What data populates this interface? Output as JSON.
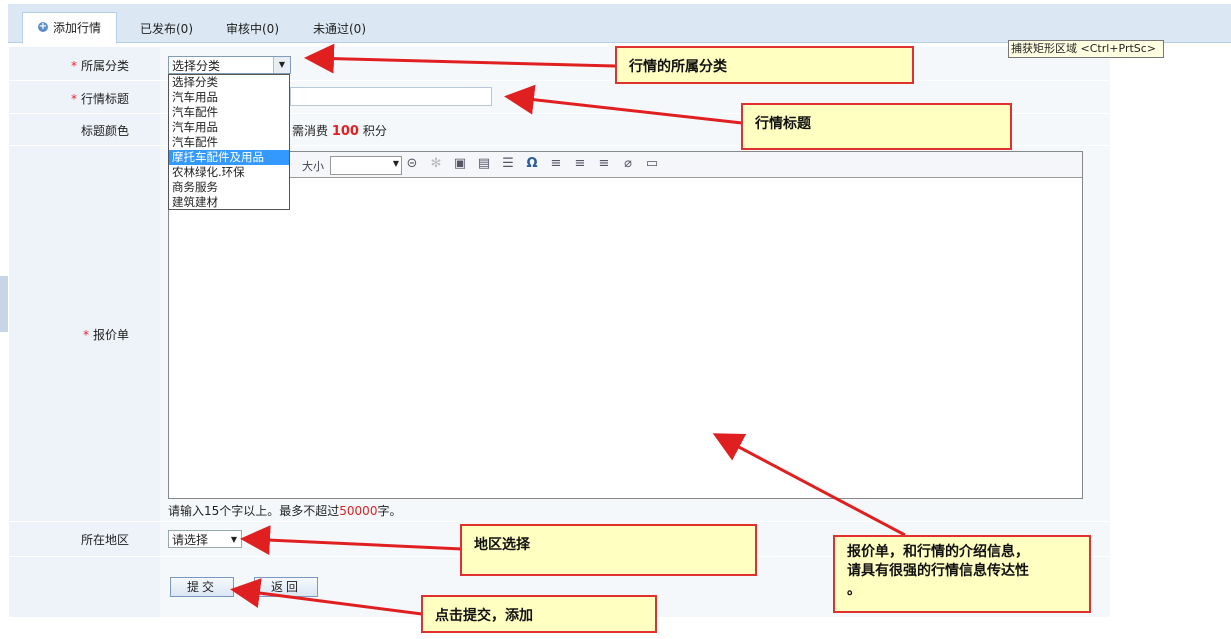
{
  "tabs": [
    {
      "label": "添加行情",
      "active": true
    },
    {
      "label": "已发布(0)"
    },
    {
      "label": "审核中(0)"
    },
    {
      "label": "未通过(0)"
    }
  ],
  "tooltip": "捕获矩形区域 <Ctrl+PrtSc>",
  "form": {
    "category_label": "所属分类",
    "category_selected": "选择分类",
    "category_options": [
      "选择分类",
      "汽车用品",
      "汽车配件",
      "汽车用品",
      "汽车配件",
      "摩托车配件及用品",
      "农林绿化.环保",
      "商务服务",
      "建筑建材"
    ],
    "category_highlight_index": 5,
    "title_label": "行情标题",
    "color_label": "标题颜色",
    "color_cost_prefix": "需消费",
    "color_cost_value": "100",
    "color_cost_suffix": "积分",
    "quote_label": "报价单",
    "editor_size_label": "大小",
    "hint_prefix": "请输入15个字以上。最多不超过",
    "hint_limit": "50000",
    "hint_suffix": "字。",
    "region_label": "所在地区",
    "region_selected": "请选择",
    "submit_label": "提交",
    "back_label": "返回"
  },
  "callouts": {
    "category": "行情的所属分类",
    "title": "行情标题",
    "region": "地区选择",
    "quote_line1": "报价单，和行情的介绍信息，",
    "quote_line2": "请具有很强的行情信息传达性",
    "quote_line3": "。",
    "submit": "点击提交，添加"
  },
  "colors": {
    "accent": "#e03030",
    "callout_bg": "#ffffc2",
    "tab_bg": "#dbe8f4",
    "label_bg": "#eef3f9"
  }
}
